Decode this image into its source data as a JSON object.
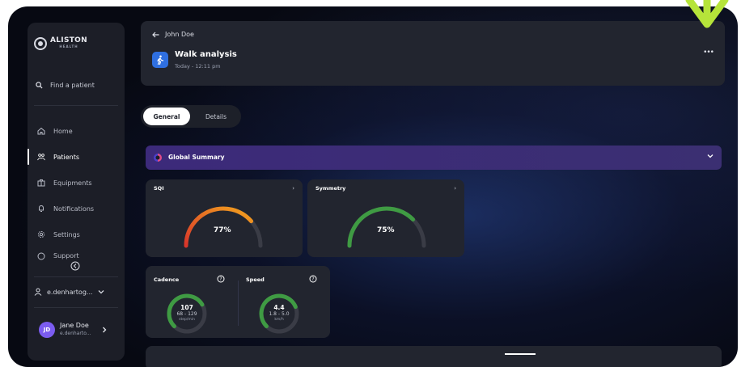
{
  "brand": {
    "name": "ALISTON",
    "tagline": "HEALTH"
  },
  "sidebar": {
    "search_label": "Find a patient",
    "items": [
      {
        "label": "Home",
        "icon": "home-icon",
        "active": false
      },
      {
        "label": "Patients",
        "icon": "patients-icon",
        "active": true
      },
      {
        "label": "Equipments",
        "icon": "equipment-icon",
        "active": false
      },
      {
        "label": "Notifications",
        "icon": "bell-icon",
        "active": false
      },
      {
        "label": "Settings",
        "icon": "gear-icon",
        "active": false
      },
      {
        "label": "Support",
        "icon": "help-icon",
        "active": false
      }
    ],
    "account": "e.denhartog...",
    "user": {
      "initials": "JD",
      "name": "Jane Doe",
      "email": "e.denharto..."
    }
  },
  "header": {
    "back_label": "John Doe",
    "title": "Walk analysis",
    "subtitle": "Today - 12:11 pm",
    "more": "•••"
  },
  "tabs": [
    {
      "label": "General",
      "active": true
    },
    {
      "label": "Details",
      "active": false
    }
  ],
  "summary": {
    "label": "Global Summary"
  },
  "cards": {
    "sqi": {
      "title": "SQI",
      "value": "77%",
      "fraction": 0.77
    },
    "symmetry": {
      "title": "Symmetry",
      "value": "75%",
      "fraction": 0.75
    }
  },
  "metrics": {
    "cadence": {
      "title": "Cadence",
      "value": "107",
      "range": "68 - 129",
      "unit": "step/min",
      "fraction": 0.72
    },
    "speed": {
      "title": "Speed",
      "value": "4.4",
      "range": "1.8 - 5.0",
      "unit": "km/h",
      "fraction": 0.75
    }
  },
  "colors": {
    "accent": "#7b5cf0",
    "summary_bar": "#3c2a7a",
    "gauge_green": "#3f9b43",
    "gauge_red": "#d9352a",
    "gauge_orange": "#ef8a1c",
    "arrow": "#b6e43a"
  }
}
